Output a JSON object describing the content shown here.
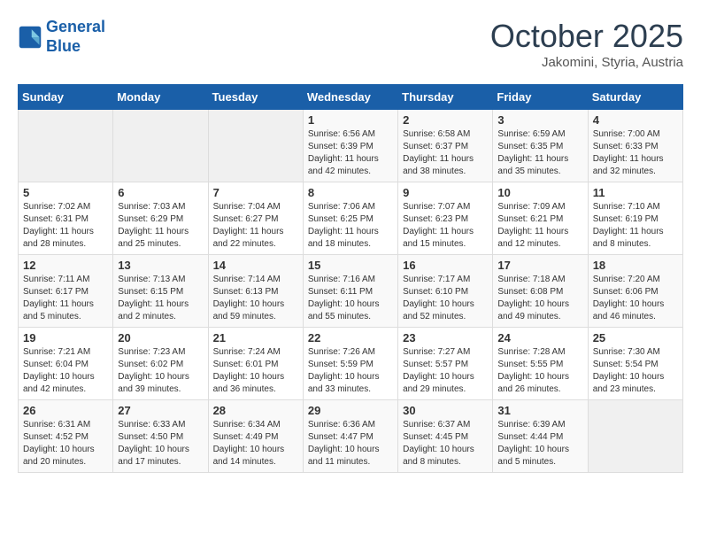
{
  "logo": {
    "line1": "General",
    "line2": "Blue"
  },
  "title": "October 2025",
  "subtitle": "Jakomini, Styria, Austria",
  "weekdays": [
    "Sunday",
    "Monday",
    "Tuesday",
    "Wednesday",
    "Thursday",
    "Friday",
    "Saturday"
  ],
  "weeks": [
    [
      {
        "day": "",
        "info": ""
      },
      {
        "day": "",
        "info": ""
      },
      {
        "day": "",
        "info": ""
      },
      {
        "day": "1",
        "info": "Sunrise: 6:56 AM\nSunset: 6:39 PM\nDaylight: 11 hours\nand 42 minutes."
      },
      {
        "day": "2",
        "info": "Sunrise: 6:58 AM\nSunset: 6:37 PM\nDaylight: 11 hours\nand 38 minutes."
      },
      {
        "day": "3",
        "info": "Sunrise: 6:59 AM\nSunset: 6:35 PM\nDaylight: 11 hours\nand 35 minutes."
      },
      {
        "day": "4",
        "info": "Sunrise: 7:00 AM\nSunset: 6:33 PM\nDaylight: 11 hours\nand 32 minutes."
      }
    ],
    [
      {
        "day": "5",
        "info": "Sunrise: 7:02 AM\nSunset: 6:31 PM\nDaylight: 11 hours\nand 28 minutes."
      },
      {
        "day": "6",
        "info": "Sunrise: 7:03 AM\nSunset: 6:29 PM\nDaylight: 11 hours\nand 25 minutes."
      },
      {
        "day": "7",
        "info": "Sunrise: 7:04 AM\nSunset: 6:27 PM\nDaylight: 11 hours\nand 22 minutes."
      },
      {
        "day": "8",
        "info": "Sunrise: 7:06 AM\nSunset: 6:25 PM\nDaylight: 11 hours\nand 18 minutes."
      },
      {
        "day": "9",
        "info": "Sunrise: 7:07 AM\nSunset: 6:23 PM\nDaylight: 11 hours\nand 15 minutes."
      },
      {
        "day": "10",
        "info": "Sunrise: 7:09 AM\nSunset: 6:21 PM\nDaylight: 11 hours\nand 12 minutes."
      },
      {
        "day": "11",
        "info": "Sunrise: 7:10 AM\nSunset: 6:19 PM\nDaylight: 11 hours\nand 8 minutes."
      }
    ],
    [
      {
        "day": "12",
        "info": "Sunrise: 7:11 AM\nSunset: 6:17 PM\nDaylight: 11 hours\nand 5 minutes."
      },
      {
        "day": "13",
        "info": "Sunrise: 7:13 AM\nSunset: 6:15 PM\nDaylight: 11 hours\nand 2 minutes."
      },
      {
        "day": "14",
        "info": "Sunrise: 7:14 AM\nSunset: 6:13 PM\nDaylight: 10 hours\nand 59 minutes."
      },
      {
        "day": "15",
        "info": "Sunrise: 7:16 AM\nSunset: 6:11 PM\nDaylight: 10 hours\nand 55 minutes."
      },
      {
        "day": "16",
        "info": "Sunrise: 7:17 AM\nSunset: 6:10 PM\nDaylight: 10 hours\nand 52 minutes."
      },
      {
        "day": "17",
        "info": "Sunrise: 7:18 AM\nSunset: 6:08 PM\nDaylight: 10 hours\nand 49 minutes."
      },
      {
        "day": "18",
        "info": "Sunrise: 7:20 AM\nSunset: 6:06 PM\nDaylight: 10 hours\nand 46 minutes."
      }
    ],
    [
      {
        "day": "19",
        "info": "Sunrise: 7:21 AM\nSunset: 6:04 PM\nDaylight: 10 hours\nand 42 minutes."
      },
      {
        "day": "20",
        "info": "Sunrise: 7:23 AM\nSunset: 6:02 PM\nDaylight: 10 hours\nand 39 minutes."
      },
      {
        "day": "21",
        "info": "Sunrise: 7:24 AM\nSunset: 6:01 PM\nDaylight: 10 hours\nand 36 minutes."
      },
      {
        "day": "22",
        "info": "Sunrise: 7:26 AM\nSunset: 5:59 PM\nDaylight: 10 hours\nand 33 minutes."
      },
      {
        "day": "23",
        "info": "Sunrise: 7:27 AM\nSunset: 5:57 PM\nDaylight: 10 hours\nand 29 minutes."
      },
      {
        "day": "24",
        "info": "Sunrise: 7:28 AM\nSunset: 5:55 PM\nDaylight: 10 hours\nand 26 minutes."
      },
      {
        "day": "25",
        "info": "Sunrise: 7:30 AM\nSunset: 5:54 PM\nDaylight: 10 hours\nand 23 minutes."
      }
    ],
    [
      {
        "day": "26",
        "info": "Sunrise: 6:31 AM\nSunset: 4:52 PM\nDaylight: 10 hours\nand 20 minutes."
      },
      {
        "day": "27",
        "info": "Sunrise: 6:33 AM\nSunset: 4:50 PM\nDaylight: 10 hours\nand 17 minutes."
      },
      {
        "day": "28",
        "info": "Sunrise: 6:34 AM\nSunset: 4:49 PM\nDaylight: 10 hours\nand 14 minutes."
      },
      {
        "day": "29",
        "info": "Sunrise: 6:36 AM\nSunset: 4:47 PM\nDaylight: 10 hours\nand 11 minutes."
      },
      {
        "day": "30",
        "info": "Sunrise: 6:37 AM\nSunset: 4:45 PM\nDaylight: 10 hours\nand 8 minutes."
      },
      {
        "day": "31",
        "info": "Sunrise: 6:39 AM\nSunset: 4:44 PM\nDaylight: 10 hours\nand 5 minutes."
      },
      {
        "day": "",
        "info": ""
      }
    ]
  ]
}
